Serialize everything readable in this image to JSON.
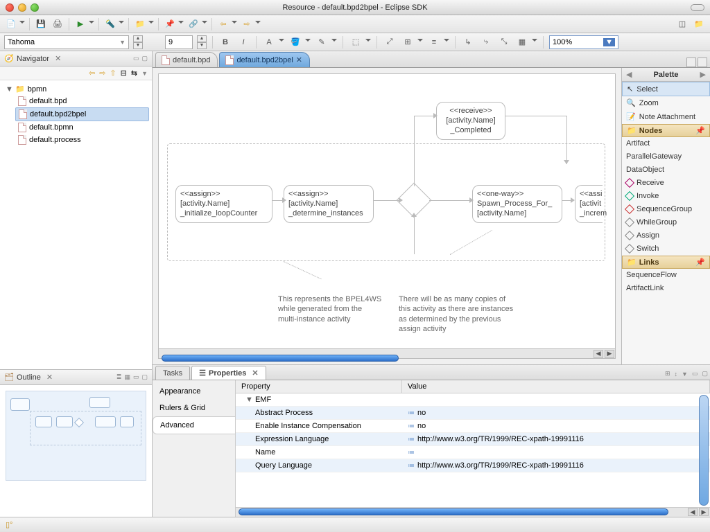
{
  "window": {
    "title": "Resource - default.bpd2bpel - Eclipse SDK"
  },
  "format": {
    "font": "Tahoma",
    "size": "9",
    "zoom": "100%"
  },
  "navigator": {
    "title": "Navigator",
    "root": "bpmn",
    "files": [
      "default.bpd",
      "default.bpd2bpel",
      "default.bpmn",
      "default.process"
    ],
    "selected": "default.bpd2bpel"
  },
  "outline": {
    "title": "Outline"
  },
  "editor": {
    "tabs": [
      {
        "label": "default.bpd",
        "active": false
      },
      {
        "label": "default.bpd2bpel",
        "active": true
      }
    ],
    "nodes": {
      "assign1": {
        "stereo": "<<assign>>",
        "line2": "[activity.Name]",
        "line3": "_initialize_loopCounter"
      },
      "assign2": {
        "stereo": "<<assign>>",
        "line2": "[activity.Name]",
        "line3": "_determine_instances"
      },
      "receive": {
        "stereo": "<<receive>>",
        "line2": "[activity.Name]",
        "line3": "_Completed"
      },
      "oneway": {
        "stereo": "<<one-way>>",
        "line2": "Spawn_Process_For_",
        "line3": "[activity.Name]"
      },
      "assign3": {
        "stereo": "<<assi",
        "line2": "[activit",
        "line3": "_increm"
      }
    },
    "notes": {
      "left": "This represents the BPEL4WS\nwhile generated from the\nmulti-instance activity",
      "right": "There will be as many copies of\nthis activity as there are instances\nas determined by the previous\nassign activity"
    }
  },
  "palette": {
    "title": "Palette",
    "tools": [
      "Select",
      "Zoom",
      "Note Attachment"
    ],
    "groups": {
      "nodes": {
        "label": "Nodes",
        "items": [
          "Artifact",
          "ParallelGateway",
          "DataObject",
          "Receive",
          "Invoke",
          "SequenceGroup",
          "WhileGroup",
          "Assign",
          "Switch"
        ]
      },
      "links": {
        "label": "Links",
        "items": [
          "SequenceFlow",
          "ArtifactLink"
        ]
      }
    }
  },
  "bottom": {
    "tabs": [
      "Tasks",
      "Properties"
    ],
    "active": "Properties",
    "categories": [
      "Appearance",
      "Rulers & Grid",
      "Advanced"
    ],
    "activeCategory": "Advanced",
    "columns": {
      "prop": "Property",
      "val": "Value"
    },
    "group": "EMF",
    "rows": [
      {
        "name": "Abstract Process",
        "value": "no"
      },
      {
        "name": "Enable Instance Compensation",
        "value": "no"
      },
      {
        "name": "Expression Language",
        "value": "http://www.w3.org/TR/1999/REC-xpath-19991116"
      },
      {
        "name": "Name",
        "value": ""
      },
      {
        "name": "Query Language",
        "value": "http://www.w3.org/TR/1999/REC-xpath-19991116"
      }
    ]
  }
}
